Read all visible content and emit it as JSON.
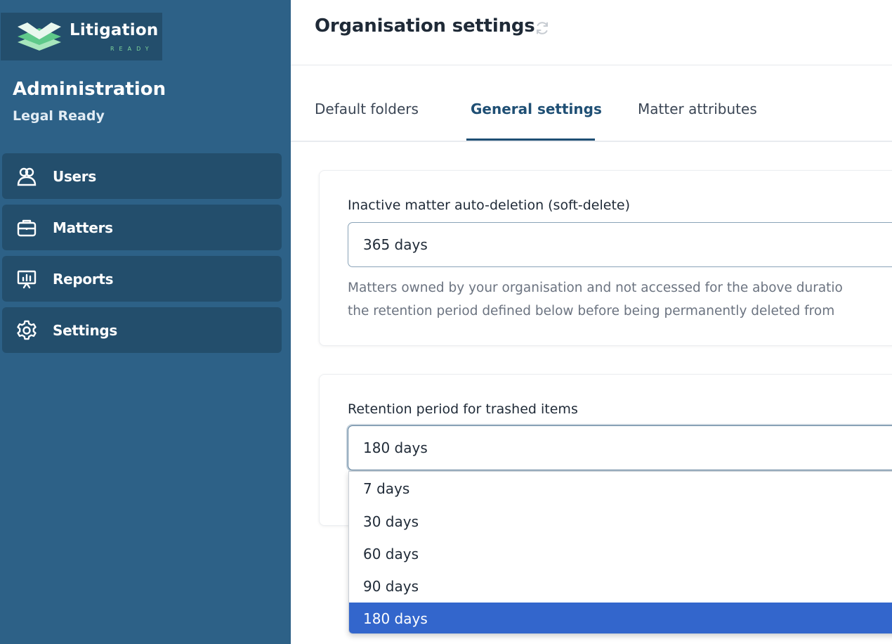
{
  "brand": {
    "name": "Litigation",
    "tagline": "READY"
  },
  "sidebar": {
    "title": "Administration",
    "org": "Legal Ready",
    "items": [
      {
        "label": "Users",
        "icon": "users-icon"
      },
      {
        "label": "Matters",
        "icon": "briefcase-icon"
      },
      {
        "label": "Reports",
        "icon": "presentation-chart-icon"
      },
      {
        "label": "Settings",
        "icon": "gear-icon"
      }
    ]
  },
  "header": {
    "title": "Organisation settings"
  },
  "tabs": [
    {
      "label": "Default folders",
      "active": false
    },
    {
      "label": "General settings",
      "active": true
    },
    {
      "label": "Matter attributes",
      "active": false
    }
  ],
  "settings": {
    "auto_deletion": {
      "label": "Inactive matter auto-deletion (soft-delete)",
      "value": "365 days",
      "help_line1": "Matters owned by your organisation and not accessed for the above duratio",
      "help_line2": "the retention period defined below before being permanently deleted from"
    },
    "retention": {
      "label": "Retention period for trashed items",
      "value": "180 days",
      "options": [
        "7 days",
        "30 days",
        "60 days",
        "90 days",
        "180 days"
      ],
      "selected_index": 4
    }
  },
  "colors": {
    "sidebar_bg": "#2d6187",
    "sidebar_item_bg": "#234e6c",
    "accent": "#1f4f74",
    "selected_option": "#3366cc",
    "logo_green": "#7fd49b"
  }
}
